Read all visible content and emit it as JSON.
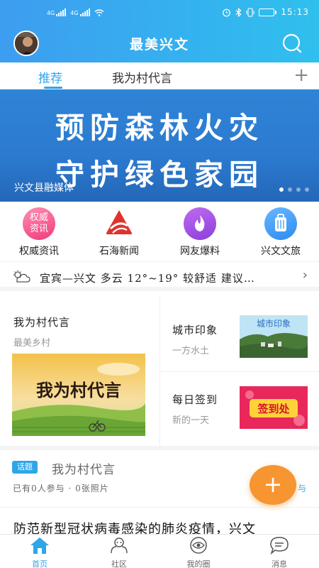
{
  "status_bar": {
    "signal_tag_1": "4G",
    "signal_tag_2": "4G",
    "battery_level": "68",
    "time": "15:13"
  },
  "header": {
    "title": "最美兴文"
  },
  "tabs": [
    {
      "label": "推荐",
      "active": true
    },
    {
      "label": "我为村代言",
      "active": false
    }
  ],
  "add_tab_symbol": "+",
  "banner": {
    "line1": "预防森林火灾",
    "line2": "守护绿色家园",
    "caption": "兴文县融媒体",
    "slide_count": 4,
    "active_slide": 1
  },
  "quick_entries": [
    {
      "label": "权威资讯",
      "icon": "news-authority-icon",
      "icon_text_1": "权威",
      "icon_text_2": "资讯"
    },
    {
      "label": "石海新闻",
      "icon": "shihai-news-logo"
    },
    {
      "label": "网友爆料",
      "icon": "flame-icon"
    },
    {
      "label": "兴文文旅",
      "icon": "luggage-icon"
    }
  ],
  "weather": {
    "text": "宜宾—兴文  多云  12°~19°  较舒适  建议…",
    "icon": "cloudy-icon"
  },
  "feature": {
    "left": {
      "title": "我为村代言",
      "subtitle": "最美乡村",
      "image_text": "我为村代言"
    },
    "right_top": {
      "title": "城市印象",
      "subtitle": "一方水土",
      "image_text": "城市印象"
    },
    "right_bottom": {
      "title": "每日签到",
      "subtitle": "新的一天",
      "image_text": "签到处"
    }
  },
  "topic": {
    "badge": "话题",
    "title": "我为村代言",
    "meta": "已有0人参与 · 0张照片",
    "more_fragment": "与"
  },
  "fab_symbol": "+",
  "news": {
    "headline": "防范新型冠状病毒感染的肺炎疫情，兴文"
  },
  "bottom_nav": [
    {
      "label": "首页",
      "icon": "home-icon",
      "active": true
    },
    {
      "label": "社区",
      "icon": "community-icon",
      "active": false
    },
    {
      "label": "我的圈",
      "icon": "circle-eye-icon",
      "active": false
    },
    {
      "label": "消息",
      "icon": "message-icon",
      "active": false
    }
  ],
  "colors": {
    "accent": "#2fa6e8",
    "header_start": "#3d9df0",
    "header_end": "#2fc0ee",
    "fab": "#f79531",
    "banner": "#2b7ad0"
  }
}
